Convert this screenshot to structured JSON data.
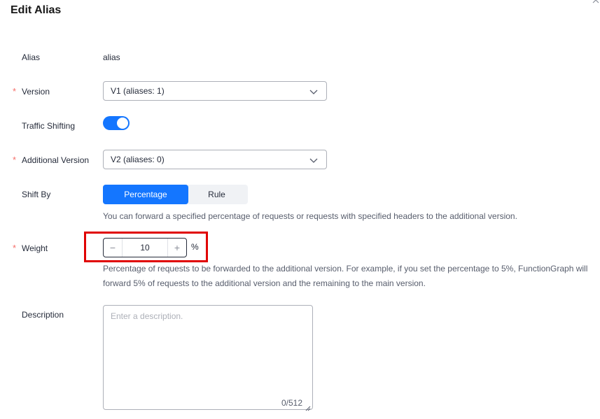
{
  "dialog": {
    "title": "Edit Alias"
  },
  "form": {
    "alias": {
      "label": "Alias",
      "value": "alias"
    },
    "version": {
      "label": "Version",
      "value": "V1 (aliases: 1)"
    },
    "traffic_shifting": {
      "label": "Traffic Shifting",
      "enabled": true
    },
    "additional_version": {
      "label": "Additional Version",
      "value": "V2 (aliases: 0)"
    },
    "shift_by": {
      "label": "Shift By",
      "options": [
        "Percentage",
        "Rule"
      ],
      "selected": "Percentage",
      "hint": "You can forward a specified percentage of requests or requests with specified headers to the additional version."
    },
    "weight": {
      "label": "Weight",
      "value": "10",
      "unit": "%",
      "minus": "−",
      "plus": "+",
      "hint_line1": "Percentage of requests to be forwarded to the additional version. For example, if you set the percentage to 5%, FunctionGraph will",
      "hint_line2": "forward 5% of requests to the additional version and the remaining to the main version."
    },
    "description": {
      "label": "Description",
      "placeholder": "Enter a description.",
      "counter": "0/512"
    }
  },
  "colors": {
    "accent": "#1476ff",
    "required": "#f66f6a",
    "highlight": "#e00000"
  }
}
